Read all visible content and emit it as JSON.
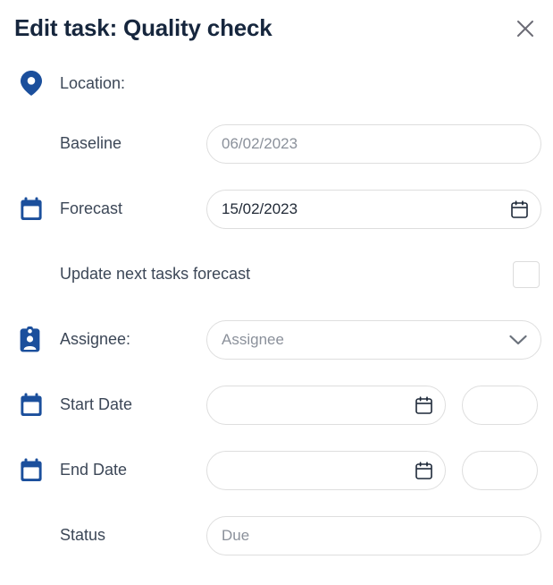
{
  "dialog": {
    "title": "Edit task: Quality check",
    "close_icon": "close-icon"
  },
  "colors": {
    "brand_blue": "#1b4f9c",
    "title_navy": "#16263d",
    "label_gray": "#3c4757",
    "placeholder_gray": "#8b919b",
    "border_gray": "#dedede",
    "close_gray": "#6b6b75"
  },
  "fields": {
    "location": {
      "label": "Location:",
      "icon": "location-pin-icon"
    },
    "baseline": {
      "label": "Baseline",
      "value": "06/02/2023",
      "is_placeholder": true
    },
    "forecast": {
      "label": "Forecast",
      "icon": "calendar-icon",
      "value": "15/02/2023",
      "is_placeholder": false,
      "field_icon": "calendar-icon"
    },
    "update_next_tasks": {
      "label": "Update next tasks forecast",
      "checked": false
    },
    "assignee": {
      "label": "Assignee:",
      "icon": "id-badge-icon",
      "placeholder": "Assignee",
      "value": "",
      "field_icon": "chevron-down-icon"
    },
    "start_date": {
      "label": "Start Date",
      "icon": "calendar-icon",
      "value": "",
      "field_icon": "calendar-icon",
      "secondary_value": ""
    },
    "end_date": {
      "label": "End Date",
      "icon": "calendar-icon",
      "value": "",
      "field_icon": "calendar-icon",
      "secondary_value": ""
    },
    "status": {
      "label": "Status",
      "value": "Due",
      "is_placeholder": true
    }
  }
}
